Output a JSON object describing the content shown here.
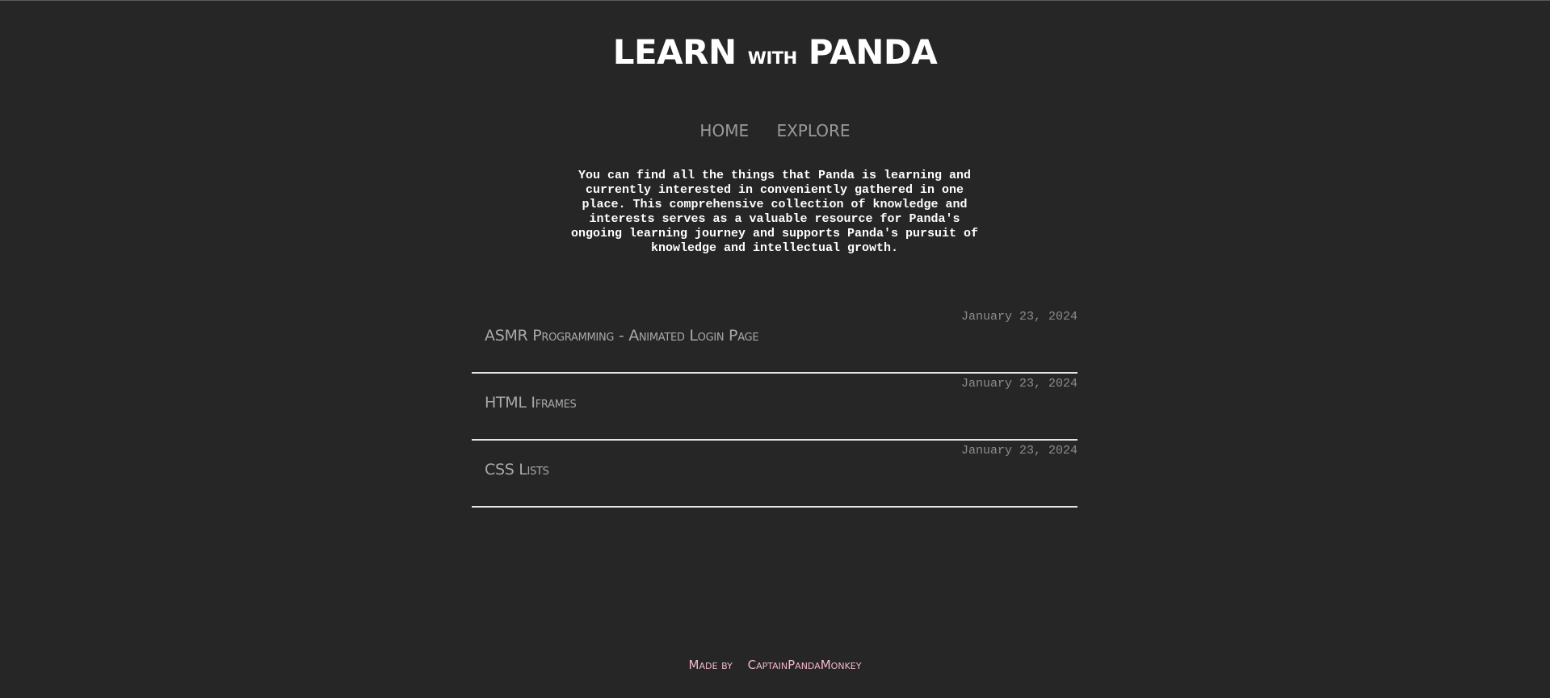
{
  "header": {
    "title_main_1": "LEARN ",
    "title_small": "with",
    "title_main_2": " PANDA"
  },
  "nav": {
    "items": [
      {
        "label": "HOME"
      },
      {
        "label": "EXPLORE"
      }
    ]
  },
  "intro": {
    "text": "You can find all the things that Panda is learning and currently interested in conveniently gathered in one place. This comprehensive collection of knowledge and interests serves as a valuable resource for Panda's ongoing learning journey and supports Panda's pursuit of knowledge and intellectual growth."
  },
  "posts": [
    {
      "date": "January 23, 2024",
      "title": "ASMR Programming - Animated Login Page"
    },
    {
      "date": "January 23, 2024",
      "title": "HTML Iframes"
    },
    {
      "date": "January 23, 2024",
      "title": "CSS Lists"
    }
  ],
  "footer": {
    "made_by": "Made by",
    "author": "CaptainPandaMonkey"
  },
  "colors": {
    "background": "#262626",
    "title": "#ffffff",
    "nav": "#9a9a9a",
    "footer": "#f3b8cc"
  }
}
